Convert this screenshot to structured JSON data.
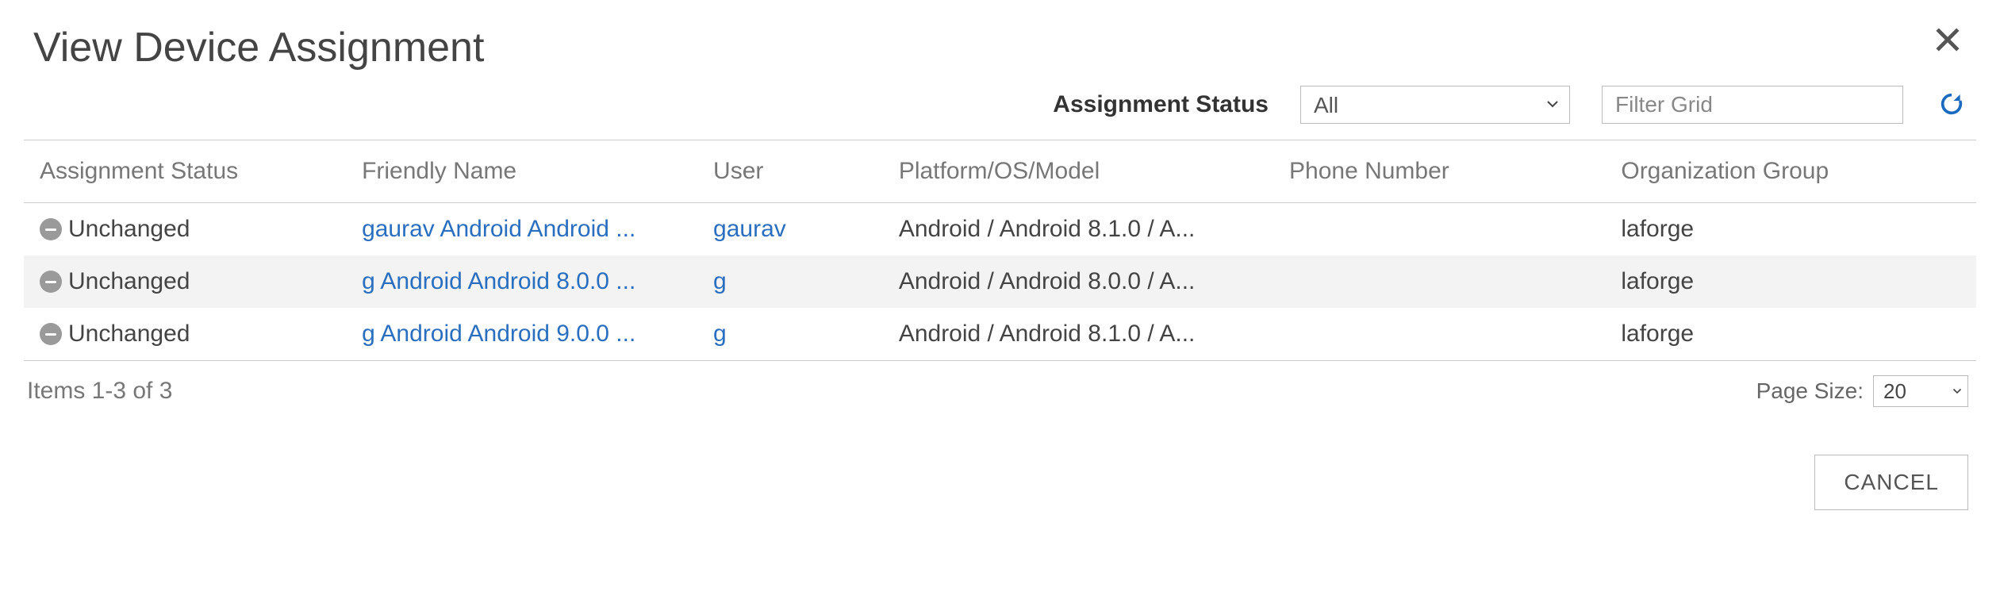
{
  "title": "View Device Assignment",
  "toolbar": {
    "status_label": "Assignment Status",
    "status_value": "All",
    "filter_placeholder": "Filter Grid"
  },
  "columns": {
    "assignment_status": "Assignment Status",
    "friendly_name": "Friendly Name",
    "user": "User",
    "platform": "Platform/OS/Model",
    "phone": "Phone Number",
    "org_group": "Organization Group"
  },
  "rows": [
    {
      "status": "Unchanged",
      "friendly_name": "gaurav Android Android ...",
      "user": "gaurav",
      "platform": "Android / Android 8.1.0 / A...",
      "phone": "",
      "org_group": "laforge"
    },
    {
      "status": "Unchanged",
      "friendly_name": "g Android Android 8.0.0 ...",
      "user": "g",
      "platform": "Android / Android 8.0.0 / A...",
      "phone": "",
      "org_group": "laforge"
    },
    {
      "status": "Unchanged",
      "friendly_name": "g Android Android 9.0.0 ...",
      "user": "g",
      "platform": "Android / Android 8.1.0 / A...",
      "phone": "",
      "org_group": "laforge"
    }
  ],
  "footer": {
    "items_text": "Items 1-3 of 3",
    "page_size_label": "Page Size:",
    "page_size_value": "20"
  },
  "buttons": {
    "cancel": "CANCEL"
  }
}
